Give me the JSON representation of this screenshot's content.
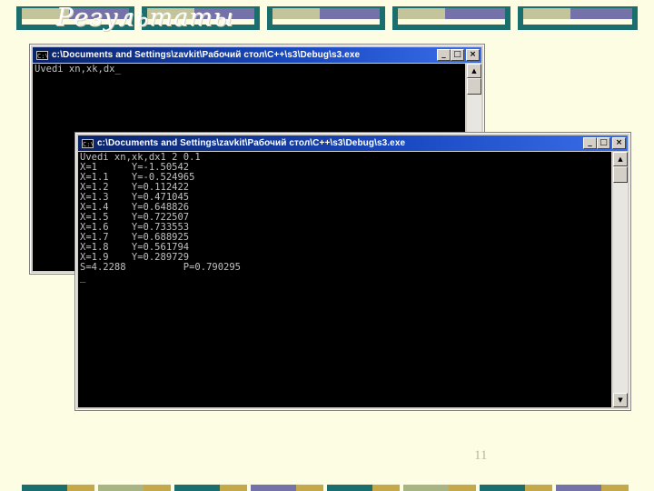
{
  "slide": {
    "title": "Результаты",
    "page_number": "11"
  },
  "back_window": {
    "title": "c:\\Documents and Settings\\zavkit\\Рабочий стол\\C++\\s3\\Debug\\s3.exe",
    "console_lines": [
      "Uvedi xn,xk,dx_"
    ]
  },
  "front_window": {
    "title": "c:\\Documents and Settings\\zavkit\\Рабочий стол\\C++\\s3\\Debug\\s3.exe",
    "console_lines": [
      "Uvedi xn,xk,dx1 2 0.1",
      "X=1      Y=-1.50542",
      "X=1.1    Y=-0.524965",
      "X=1.2    Y=0.112422",
      "X=1.3    Y=0.471045",
      "X=1.4    Y=0.648826",
      "X=1.5    Y=0.722507",
      "X=1.6    Y=0.733553",
      "X=1.7    Y=0.688925",
      "X=1.8    Y=0.561794",
      "X=1.9    Y=0.289729",
      "S=4.2288          P=0.790295",
      "_"
    ]
  },
  "window_buttons": {
    "minimize": "_",
    "maximize": "□",
    "close": "×"
  },
  "scrollbar": {
    "up": "▲",
    "down": "▼"
  },
  "colors": {
    "background": "#fdfde4",
    "band_teal": "#1b6e6e",
    "band_gold": "#c4a84a",
    "band_olive": "#a8b484",
    "band_purple": "#7472a8",
    "titlebar": "#0a246a",
    "console_bg": "#000000",
    "console_fg": "#c0c0c0"
  }
}
